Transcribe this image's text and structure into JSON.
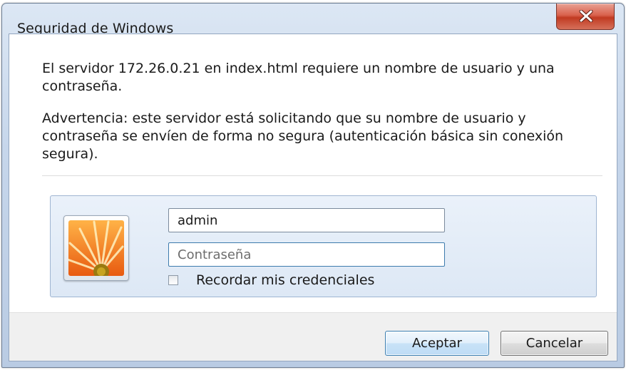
{
  "window": {
    "title": "Seguridad de Windows",
    "close_icon": "close-icon"
  },
  "message": {
    "server_text": "El servidor 172.26.0.21 en index.html requiere un nombre de usuario y una contraseña.",
    "warning_text": "Advertencia: este servidor está solicitando que su nombre de usuario y contraseña se envíen de forma no segura (autenticación básica sin conexión segura)."
  },
  "credentials": {
    "user_tile_icon": "flower-avatar-icon",
    "username_value": "admin",
    "password_placeholder": "Contraseña",
    "password_value": "",
    "remember_label": "Recordar mis credenciales",
    "remember_checked": false
  },
  "buttons": {
    "ok_label": "Aceptar",
    "cancel_label": "Cancelar"
  },
  "colors": {
    "close_button": "#c13b22",
    "panel_border": "#9fb5d2",
    "ok_border": "#3c7fb1"
  }
}
